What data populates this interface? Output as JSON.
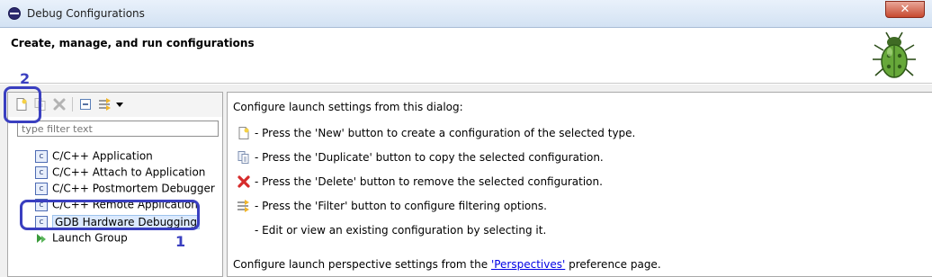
{
  "window": {
    "title": "Debug Configurations",
    "close_label": "✕"
  },
  "header": {
    "heading": "Create, manage, and run configurations"
  },
  "left": {
    "filter_placeholder": "type filter text",
    "tree": [
      {
        "label": "C/C++ Application"
      },
      {
        "label": "C/C++ Attach to Application"
      },
      {
        "label": "C/C++ Postmortem Debugger"
      },
      {
        "label": "C/C++ Remote Application"
      },
      {
        "label": "GDB Hardware Debugging",
        "selected": true
      },
      {
        "label": "Launch Group"
      }
    ]
  },
  "right": {
    "intro": "Configure launch settings from this dialog:",
    "rows": [
      {
        "icon": "new-icon",
        "text": "- Press the 'New' button to create a configuration of the selected type."
      },
      {
        "icon": "duplicate-icon",
        "text": "- Press the 'Duplicate' button to copy the selected configuration."
      },
      {
        "icon": "delete-icon",
        "text": "- Press the 'Delete' button to remove the selected configuration."
      },
      {
        "icon": "filter-icon",
        "text": "- Press the 'Filter' button to configure filtering options."
      },
      {
        "icon": "none",
        "text": "- Edit or view an existing configuration by selecting it."
      }
    ],
    "footer_prefix": "Configure launch perspective settings from the ",
    "footer_link": "'Perspectives'",
    "footer_suffix": " preference page."
  },
  "annotations": {
    "one": "1",
    "two": "2"
  },
  "colors": {
    "annotation": "#3a3fc0",
    "link": "#0000e5",
    "delete": "#d62b2b"
  }
}
